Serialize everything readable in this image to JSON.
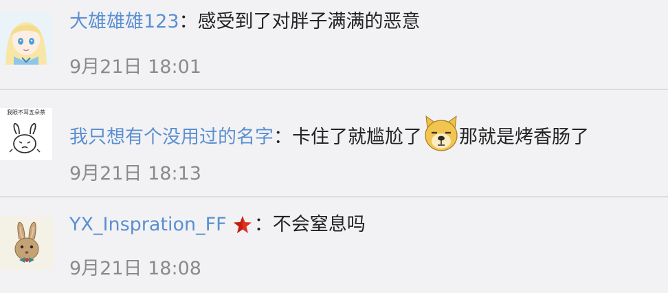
{
  "comments": [
    {
      "avatar_icon": "anime-girl-avatar-icon",
      "username": "大雄雄雄123",
      "separator": "：",
      "text": "感受到了对胖子满满的恶意",
      "time": "9月21日  18:01"
    },
    {
      "avatar_icon": "rabbit-sketch-avatar-icon",
      "avatar_caption": "我眼不耳五朵茶",
      "username": "我只想有个没用过的名字",
      "separator": "：",
      "text_before": "卡住了就尴尬了",
      "emoji_icon": "doge-emoji-icon",
      "text_after": "那就是烤香肠了",
      "time": "9月21日  18:13"
    },
    {
      "avatar_icon": "bunny-bowtie-avatar-icon",
      "username": "YX_Inspration_FF",
      "badge_icon": "red-star-icon",
      "separator": "：",
      "text": "不会窒息吗",
      "time": "9月21日  18:08"
    }
  ],
  "colors": {
    "background": "#f2f2f5",
    "username": "#5b8fd0",
    "text": "#222222",
    "time": "#8a8a8a",
    "divider": "#dcdce0",
    "star": "#e0301e"
  }
}
